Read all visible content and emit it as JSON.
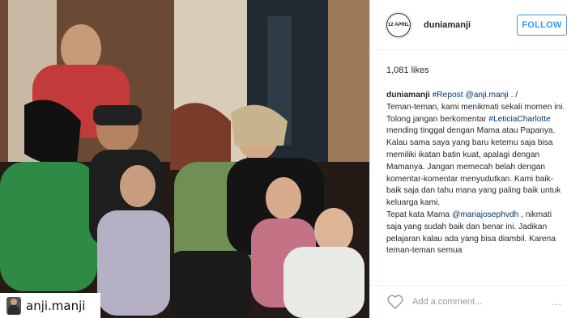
{
  "photo": {
    "repost_username": "anji.manji"
  },
  "post": {
    "avatar_text": "12 APRIL",
    "username": "duniamanji",
    "follow_label": "FOLLOW",
    "likes": "1,081 likes",
    "caption": {
      "author": "duniamanji",
      "repost_tag": "#Repost",
      "repost_mention": "@anji.manji",
      "line1_rest": " . /",
      "line2": "Teman-teman, kami menikmati sekali momen ini. Tolong jangan berkomentar ",
      "tag_leticia": "#LeticiaCharlotte",
      "line2_rest": " mending tinggal dengan Mama atau Papanya.",
      "para2": "Kalau sama saya yang baru ketemu saja bisa memiliki ikatan batin kuat, apalagi dengan Mamanya. Jangan memecah belah dengan komentar-komentar menyudutkan. Kami baik-baik saja dan tahu mana yang paling baik untuk keluarga kami.",
      "para3_start": "Tepat kata Mama ",
      "mention_maria": "@mariajosephvdh",
      "para3_rest": " , nikmati saja yang sudah baik dan benar ini. Jadikan pelajaran kalau ada yang bisa diambil. Karena teman-teman semua"
    },
    "comment_placeholder": "Add a comment...",
    "more_label": "...",
    "icons": {
      "heart": "heart-icon",
      "more": "more-options-icon"
    }
  }
}
